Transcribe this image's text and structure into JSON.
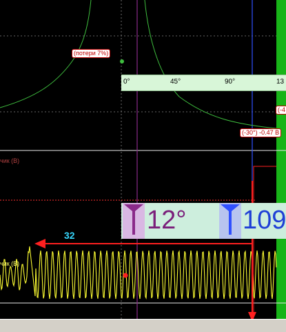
{
  "labels": {
    "loss": "(потери 7%)",
    "marker_right": "(-4",
    "cursor_readout": "(-30°) -0.47 В",
    "channel_top": "чик (В)",
    "channel_bottom": "чик (В)",
    "count": "32"
  },
  "angle_scale": [
    "0°",
    "45°",
    "90°",
    "13"
  ],
  "measure": {
    "phase1": "12°",
    "phase2": "109"
  },
  "colors": {
    "curve": "#3fbf3f",
    "signal": "#ffff33",
    "arrow": "#ff2020",
    "cursor_blue": "#3050ff",
    "cursor_purple": "#8a2a8a",
    "green_bar": "#18b418"
  }
}
